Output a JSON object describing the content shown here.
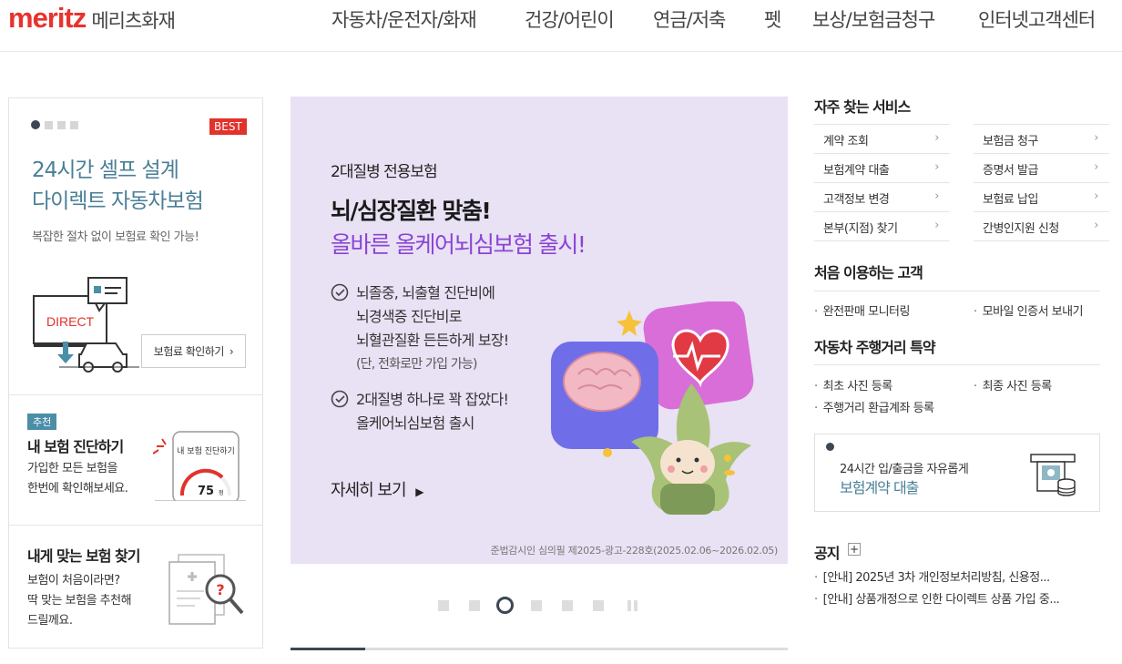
{
  "header": {
    "logo_word": "meritz",
    "logo_kor": "메리츠화재",
    "nav": [
      "자동차/운전자/화재",
      "건강/어린이",
      "연금/저축",
      "펫",
      "보상/보험금청구",
      "인터넷고객센터"
    ]
  },
  "left": {
    "best_badge": "BEST",
    "promo_title_line1": "24시간 셀프 설계",
    "promo_title_line2": "다이렉트 자동차보험",
    "promo_sub": "복잡한 절차 없이 보험료 확인 가능!",
    "direct_label": "DIRECT",
    "quote_button": "보험료 확인하기",
    "diag": {
      "tag": "추천",
      "title": "내 보험 진단하기",
      "desc_line1": "가입한 모든 보험을",
      "desc_line2": "한번에 확인해보세요.",
      "phone_caption": "내 보험 진단하기",
      "score": "75",
      "score_unit": "점"
    },
    "find": {
      "title": "내게 맞는 보험 찾기",
      "desc_line1": "보험이 처음이라면?",
      "desc_line2": "딱 맞는 보험을 추천해",
      "desc_line3": "드릴께요."
    }
  },
  "banner": {
    "kicker": "2대질병 전용보험",
    "headline1": "뇌/심장질환 맞춤!",
    "headline2": "올바른 올케어뇌심보험 출시!",
    "check1_line1": "뇌졸중, 뇌출혈 진단비에",
    "check1_line2": "뇌경색증 진단비로",
    "check1_line3": "뇌혈관질환 든든하게 보장!",
    "check1_note": "(단, 전화로만 가입 가능)",
    "check2_line1": "2대질병 하나로 꽉 잡았다!",
    "check2_line2": "올케어뇌심보험 출시",
    "more": "자세히 보기",
    "legal": "준법감시인 심의필 제2025-광고-228호(2025.02.06~2026.02.05)",
    "accent_color": "#8a45d4",
    "bg_color": "#e9e1f4"
  },
  "carousel": {
    "active_index": 2,
    "progress": 0.15
  },
  "right": {
    "freq_title": "자주 찾는 서비스",
    "services": [
      {
        "label": "계약 조회"
      },
      {
        "label": "보험금 청구"
      },
      {
        "label": "보험계약 대출"
      },
      {
        "label": "증명서 발급"
      },
      {
        "label": "고객정보 변경"
      },
      {
        "label": "보험료 납입"
      },
      {
        "label": "본부(지점) 찾기"
      },
      {
        "label": "간병인지원 신청"
      }
    ],
    "first_title": "처음 이용하는 고객",
    "first_links": [
      "완전판매 모니터링",
      "모바일 인증서 보내기"
    ],
    "mileage_title": "자동차 주행거리 특약",
    "mileage_links": [
      "최초 사진 등록",
      "최종 사진 등록",
      "주행거리 환급계좌 등록"
    ],
    "loan_line1": "24시간 입/출금을 자유롭게",
    "loan_line2": "보험계약 대출",
    "notice_title": "공지",
    "notices": [
      "[안내] 2025년 3차 개인정보처리방침, 신용정...",
      "[안내] 상품개정으로 인한 다이렉트 상품 가입 중..."
    ]
  }
}
